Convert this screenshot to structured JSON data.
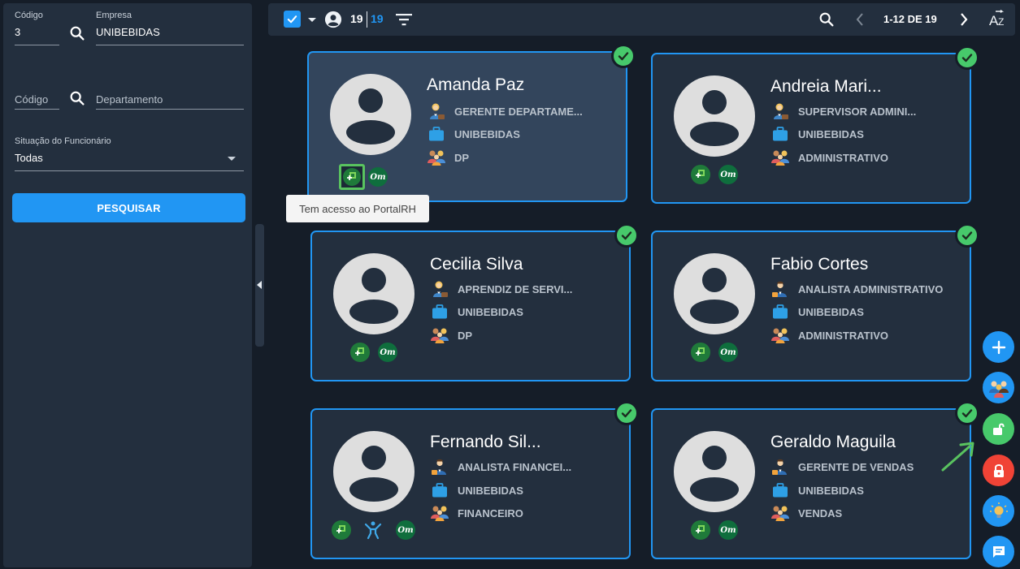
{
  "filters": {
    "codigo_empresa": {
      "label": "Código",
      "value": "3"
    },
    "empresa": {
      "label": "Empresa",
      "value": "UNIBEBIDAS"
    },
    "codigo_departamento": {
      "placeholder": "Código"
    },
    "departamento": {
      "placeholder": "Departamento"
    },
    "situacao": {
      "label": "Situação do Funcionário",
      "value": "Todas"
    },
    "search_button": "PESQUISAR"
  },
  "toolbar": {
    "count_selected": "19",
    "count_total": "19",
    "page_range": "1-12 DE 19"
  },
  "tooltip": "Tem acesso ao PortalRH",
  "employees": [
    {
      "name": "Amanda Paz",
      "role": "GERENTE DEPARTAME...",
      "company": "UNIBEBIDAS",
      "department": "DP",
      "role_icon": "woman-office-worker-icon"
    },
    {
      "name": "Andreia Mari...",
      "role": "SUPERVISOR ADMINI...",
      "company": "UNIBEBIDAS",
      "department": "ADMINISTRATIVO",
      "role_icon": "woman-office-worker-icon"
    },
    {
      "name": "Cecilia Silva",
      "role": "APRENDIZ DE SERVI...",
      "company": "UNIBEBIDAS",
      "department": "DP",
      "role_icon": "woman-office-worker-icon"
    },
    {
      "name": "Fabio Cortes",
      "role": "ANALISTA ADMINISTRATIVO",
      "company": "UNIBEBIDAS",
      "department": "ADMINISTRATIVO",
      "role_icon": "man-office-worker-icon"
    },
    {
      "name": "Fernando Sil...",
      "role": "ANALISTA FINANCEI...",
      "company": "UNIBEBIDAS",
      "department": "FINANCEIRO",
      "role_icon": "man-office-worker-icon"
    },
    {
      "name": "Geraldo Maguila",
      "role": "GERENTE DE VENDAS",
      "company": "UNIBEBIDAS",
      "department": "VENDAS",
      "role_icon": "man-office-worker-icon"
    }
  ],
  "badges": {
    "om": "Om"
  },
  "colors": {
    "accent": "#2196f3",
    "success": "#47c96b",
    "danger": "#f04336",
    "panel": "#232f3e",
    "background": "#151d28"
  }
}
